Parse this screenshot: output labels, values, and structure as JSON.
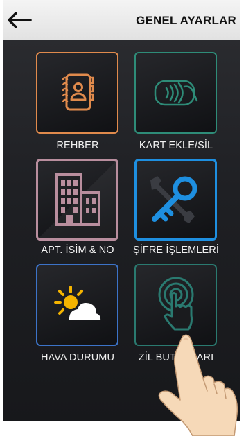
{
  "header": {
    "title": "GENEL AYARLAR",
    "back_icon": "arrow-left-icon"
  },
  "menu": {
    "items": [
      {
        "label": "REHBER",
        "icon": "address-book-icon",
        "color": "#e08a4c"
      },
      {
        "label": "KART EKLE/SİL",
        "icon": "contactless-card-icon",
        "color": "#2e8c78"
      },
      {
        "label": "APT. İSİM & NO",
        "icon": "building-icon",
        "color": "#b98e9e"
      },
      {
        "label": "ŞİFRE İŞLEMLERİ",
        "icon": "key-wrench-icon",
        "color": "#1e8fe0"
      },
      {
        "label": "HAVA DURUMU",
        "icon": "weather-sun-cloud-icon",
        "color": "#3c73c8"
      },
      {
        "label": "ZİL BUTONLARI",
        "icon": "doorbell-touch-icon",
        "color": "#2a7a70"
      }
    ]
  }
}
